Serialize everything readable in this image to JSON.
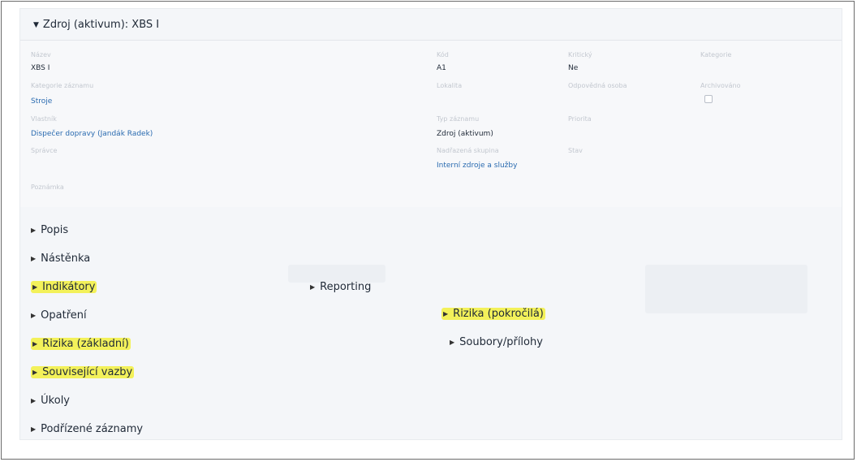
{
  "panel": {
    "title": "Zdroj (aktivum): XBS I"
  },
  "details": {
    "col1": {
      "name_label": "Název",
      "name_value": "XBS I",
      "category_label": "Kategorie záznamu",
      "category_value": "Stroje",
      "owner_label": "Vlastník",
      "owner_value": "Dispečer dopravy (Jandák Radek)",
      "manager_label": "Správce",
      "note_label": "Poznámka"
    },
    "col2": {
      "code_label": "Kód",
      "code_value": "A1",
      "location_label": "Lokalita",
      "type_label": "Typ záznamu",
      "type_value": "Zdroj (aktivum)",
      "parent_label": "Nadřazená skupina",
      "parent_value": "Interní zdroje a služby"
    },
    "col3": {
      "critical_label": "Kritický",
      "critical_value": "Ne",
      "responsible_label": "Odpovědná osoba",
      "priority_label": "Priorita",
      "status_label": "Stav"
    },
    "col4": {
      "tags_label": "Kategorie",
      "archived_label": "Archivováno"
    }
  },
  "sections": {
    "left": [
      {
        "label": "Popis",
        "highlight": false
      },
      {
        "label": "Nástěnka",
        "highlight": false
      },
      {
        "label": "Indikátory",
        "highlight": true
      },
      {
        "label": "Opatření",
        "highlight": false
      },
      {
        "label": "Rizika (základní)",
        "highlight": true
      },
      {
        "label": "Související vazby",
        "highlight": true
      },
      {
        "label": "Úkoly",
        "highlight": false
      },
      {
        "label": "Podřízené záznamy",
        "highlight": false
      }
    ],
    "middle": [
      {
        "label": "Reporting",
        "highlight": false
      }
    ],
    "right": [
      {
        "label": "Rizika (pokročilá)",
        "highlight": true
      },
      {
        "label": "Soubory/přílohy",
        "highlight": false
      }
    ]
  },
  "colors": {
    "highlight": "#f3f15a",
    "link": "#2a6bb0",
    "panel_bg": "#f4f6f9"
  }
}
